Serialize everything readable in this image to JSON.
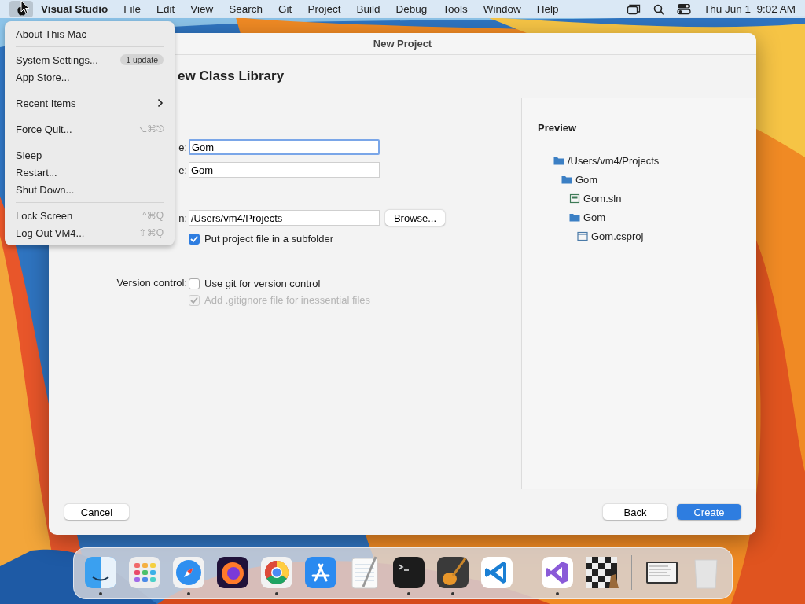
{
  "menu_bar": {
    "app_name": "Visual Studio",
    "apple_menu_open": true,
    "menus": [
      "File",
      "Edit",
      "View",
      "Search",
      "Git",
      "Project",
      "Build",
      "Debug",
      "Tools",
      "Window",
      "Help"
    ],
    "status_icons": [
      {
        "kind": "windows"
      },
      {
        "kind": "search"
      },
      {
        "kind": "control"
      }
    ],
    "clock": "Thu Jun 1  9:02 AM"
  },
  "apple_menu": [
    [
      {
        "label": "About This Mac"
      }
    ],
    [
      {
        "label": "System Settings...",
        "badge": "1 update"
      },
      {
        "label": "App Store..."
      }
    ],
    [
      {
        "label": "Recent Items",
        "submenu": true
      }
    ],
    [
      {
        "label": "Force Quit...",
        "shortcut": "⌥⌘⎋"
      }
    ],
    [
      {
        "label": "Sleep"
      },
      {
        "label": "Restart..."
      },
      {
        "label": "Shut Down..."
      }
    ],
    [
      {
        "label": "Lock Screen",
        "shortcut": "^⌘Q"
      },
      {
        "label": "Log Out VM4...",
        "shortcut": "⇧⌘Q"
      }
    ]
  ],
  "dialog": {
    "title": "New Project",
    "heading": "ew Class Library",
    "fields": [
      {
        "label": "e:",
        "value": "Gom",
        "focused": true
      },
      {
        "label": "e:",
        "value": "Gom",
        "focused": false
      }
    ],
    "location": {
      "label": "n:",
      "value": "/Users/vm4/Projects",
      "button": "Browse..."
    },
    "subfolder": {
      "label": "Put project file in a subfolder",
      "checked": true,
      "disabled": false
    },
    "version_control": {
      "label": "Version control:",
      "options": [
        {
          "label": "Use git for version control",
          "checked": false,
          "disabled": false
        },
        {
          "label": "Add .gitignore file for inessential files",
          "checked": true,
          "disabled": true
        }
      ]
    },
    "preview": {
      "title": "Preview",
      "tree": [
        {
          "label": "/Users/vm4/Projects",
          "kind": "folder",
          "children": [
            {
              "label": "Gom",
              "kind": "folder",
              "children": [
                {
                  "label": "Gom.sln",
                  "kind": "solution"
                },
                {
                  "label": "Gom",
                  "kind": "folder",
                  "children": [
                    {
                      "label": "Gom.csproj",
                      "kind": "project"
                    }
                  ]
                }
              ]
            }
          ]
        }
      ]
    },
    "buttons": [
      {
        "label": "Cancel",
        "kind": "plain"
      },
      {
        "label": "Back",
        "kind": "plain"
      },
      {
        "label": "Create",
        "kind": "primary"
      }
    ]
  },
  "dock": [
    {
      "kind": "finder",
      "running": true
    },
    {
      "kind": "launchpad",
      "running": false
    },
    {
      "kind": "safari",
      "running": true
    },
    {
      "kind": "firefox",
      "running": false
    },
    {
      "kind": "chrome",
      "running": true
    },
    {
      "kind": "appstore",
      "running": false
    },
    {
      "kind": "textedit",
      "running": false
    },
    {
      "kind": "terminal",
      "running": true
    },
    {
      "kind": "guitar",
      "running": true
    },
    {
      "kind": "vscode",
      "running": false
    },
    {
      "kind": "divider"
    },
    {
      "kind": "vs",
      "running": true
    },
    {
      "kind": "chess",
      "running": false
    },
    {
      "kind": "divider"
    },
    {
      "kind": "window",
      "running": false
    },
    {
      "kind": "trash",
      "running": false
    }
  ]
}
